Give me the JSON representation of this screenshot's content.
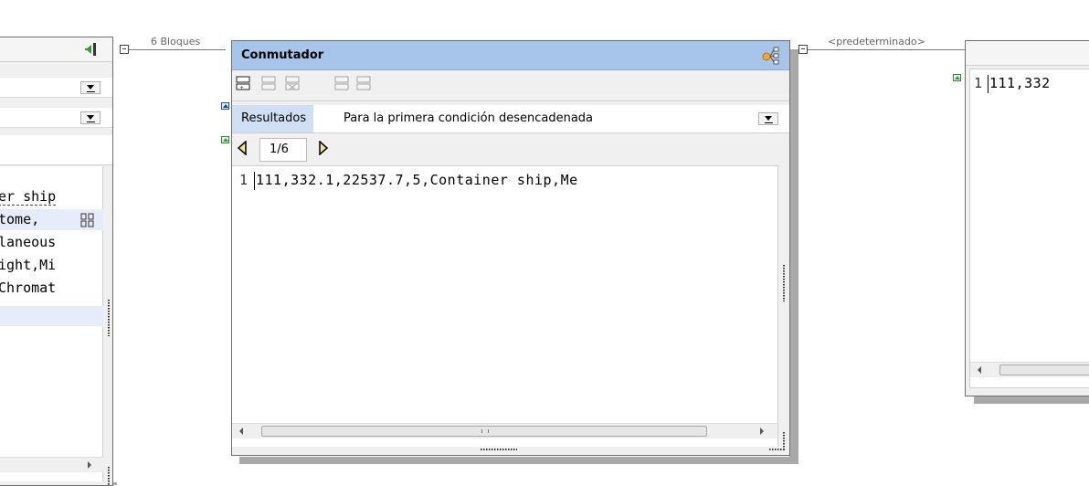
{
  "connectors": {
    "left_label": "6 Bloques",
    "right_label": "<predeterminado>"
  },
  "left_window": {
    "code_lines": [
      "er ship",
      "tome,",
      "laneous",
      "ight,Mi",
      "Chromat"
    ]
  },
  "switch_window": {
    "title": "Conmutador",
    "results_label": "Resultados",
    "mode_value": "Para la primera condición desencadenada",
    "pager_value": "1/6",
    "line_number": "1",
    "line_text": "111,332.1,22537.7,5,Container ship,Me"
  },
  "right_window": {
    "line_number": "1",
    "line_text": "111,332"
  },
  "colors": {
    "title_blue": "#a7c5ea",
    "row_blue": "#cfe0f5",
    "highlight_row": "#e6ecfa"
  }
}
